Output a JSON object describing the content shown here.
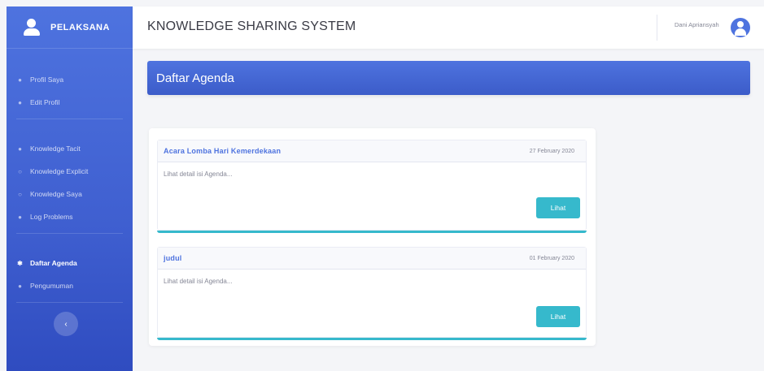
{
  "brand": {
    "name": "PELAKSANA"
  },
  "sidebar": {
    "sections": [
      {
        "heading": "",
        "items": [
          {
            "label": "Profil Saya",
            "icon": "user-icon"
          },
          {
            "label": "Edit Profil",
            "icon": "user-edit-icon"
          }
        ]
      },
      {
        "heading": "",
        "items": [
          {
            "label": "Knowledge Tacit",
            "icon": "lightbulb-icon"
          },
          {
            "label": "Knowledge Explicit",
            "icon": "lightbulb-outline-icon"
          },
          {
            "label": "Knowledge Saya",
            "icon": "book-icon"
          },
          {
            "label": "Log Problems",
            "icon": "circle-icon"
          }
        ]
      },
      {
        "heading": "",
        "items": [
          {
            "label": "Daftar Agenda",
            "icon": "info-circle-icon",
            "active": true
          },
          {
            "label": "Pengumuman",
            "icon": "user-icon"
          }
        ]
      }
    ],
    "toggle_icon": "chevron-left-icon"
  },
  "topbar": {
    "title": "KNOWLEDGE SHARING SYSTEM",
    "user_name": "Dani Apriansyah",
    "avatar_icon": "user-circle-icon"
  },
  "banner": {
    "heading": "Daftar Agenda"
  },
  "agendas": [
    {
      "title": "Acara Lomba Hari Kemerdekaan",
      "date": "27 February 2020",
      "description": "Lihat detail isi Agenda...",
      "button_label": "Lihat"
    },
    {
      "title": "judul",
      "date": "01 February 2020",
      "description": "Lihat detail isi Agenda...",
      "button_label": "Lihat"
    }
  ],
  "colors": {
    "primary": "#4e73df",
    "info": "#36b9cc",
    "text_muted": "#858796"
  }
}
